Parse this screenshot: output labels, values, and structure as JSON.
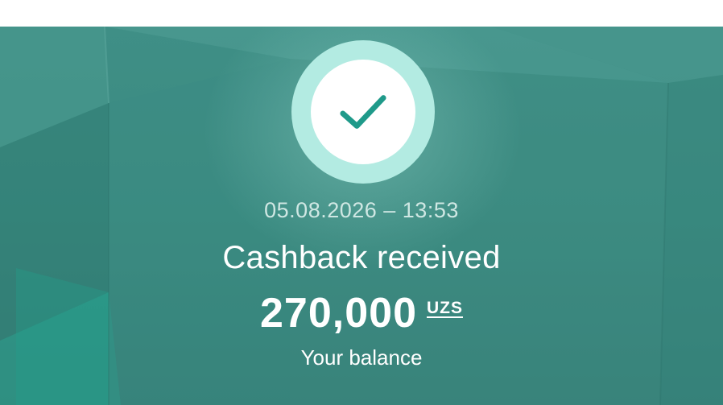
{
  "notification": {
    "icon": "checkmark-icon",
    "datetime": "05.08.2026 – 13:53",
    "title": "Cashback received",
    "amount": "270,000",
    "currency": "UZS",
    "balance_label": "Your balance"
  },
  "colors": {
    "banner_bg": "#3f8f86",
    "check_ring": "#b3ebe2",
    "check_mark": "#1f9a8a",
    "text_primary": "#ffffff",
    "text_secondary": "#cfe7e3"
  }
}
